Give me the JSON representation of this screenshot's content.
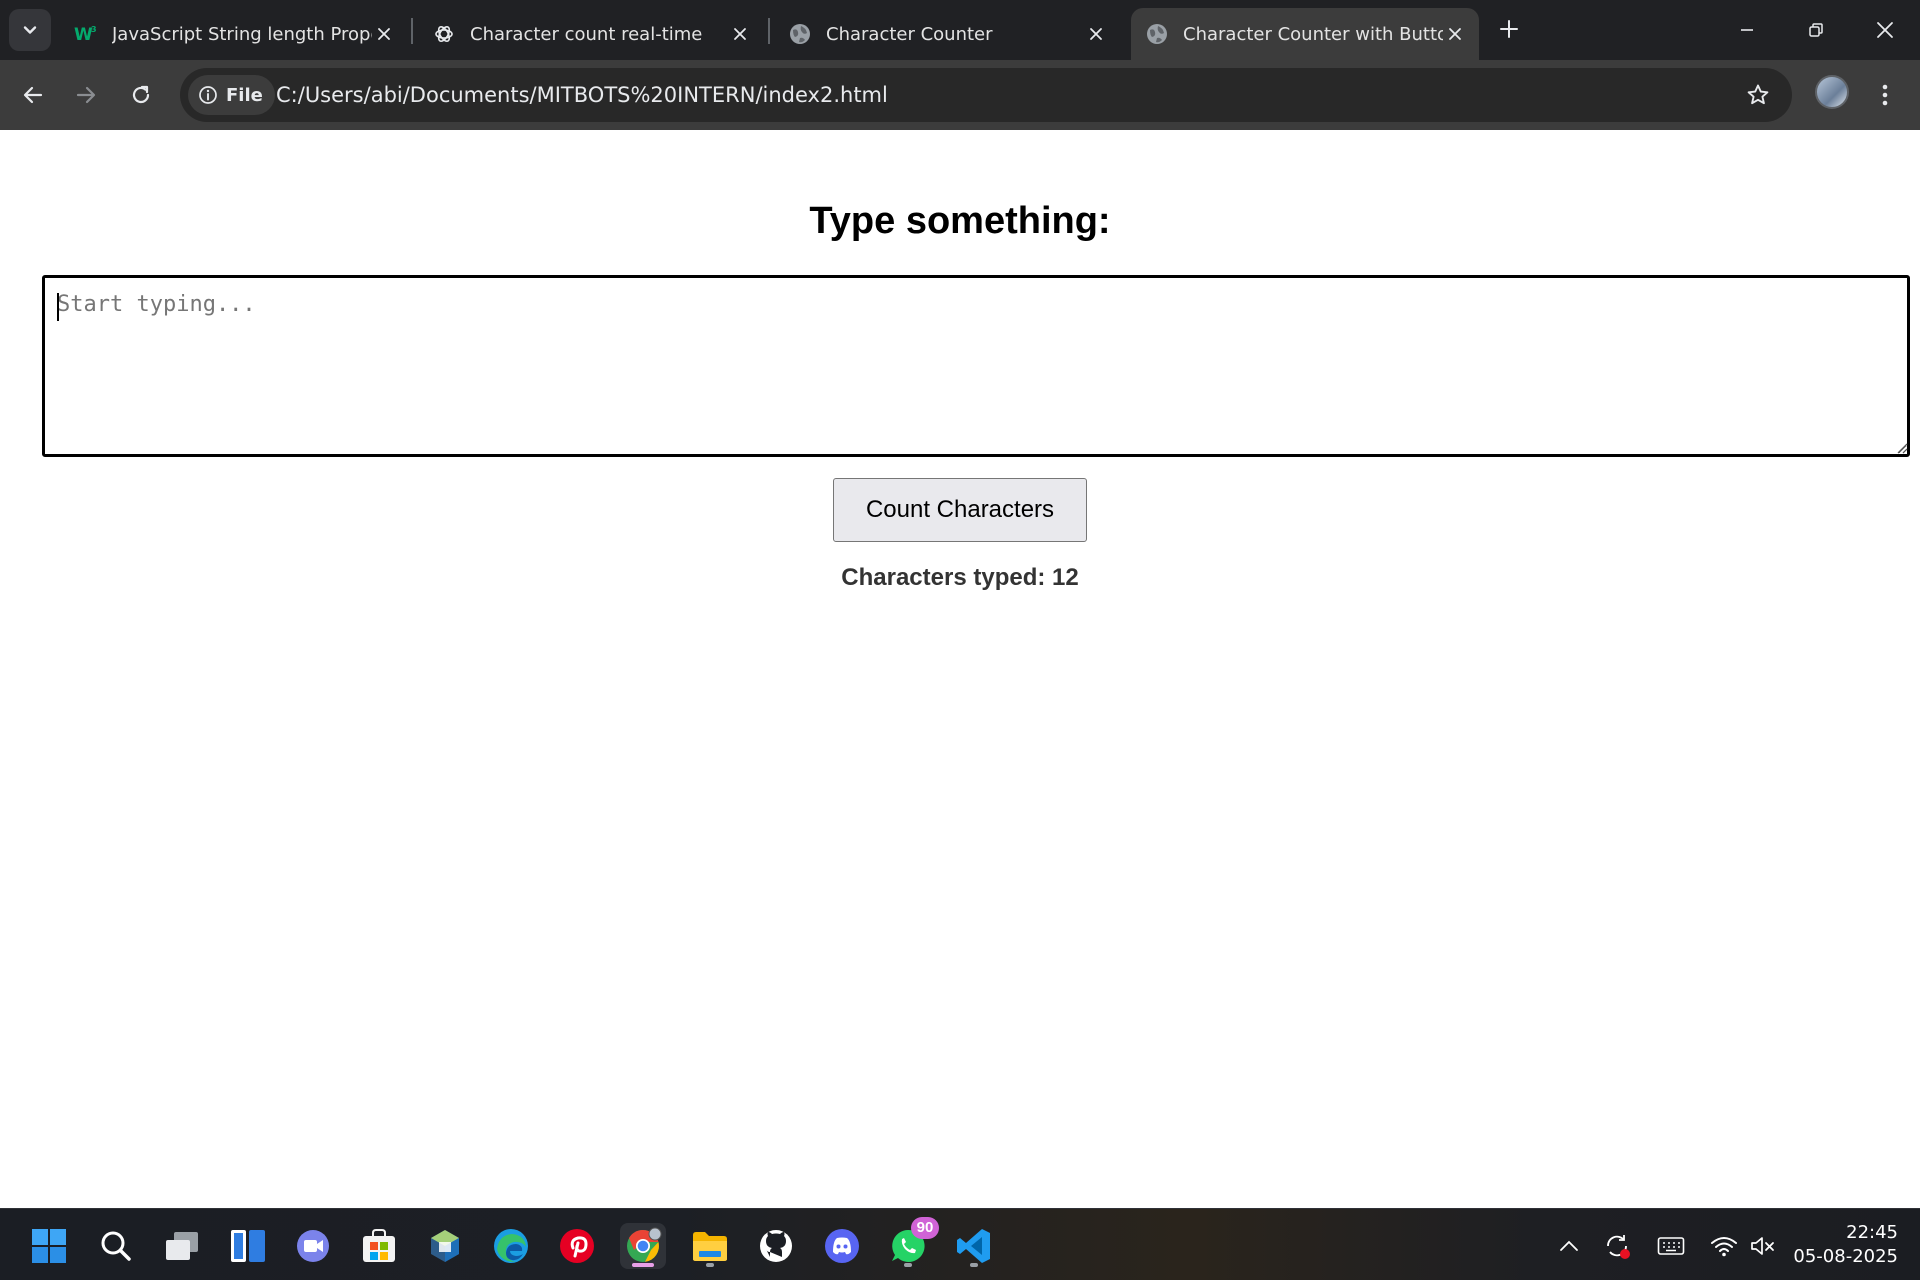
{
  "browser": {
    "tabs": [
      {
        "title": "JavaScript String length Propert",
        "favicon": "w3schools-icon",
        "active": false
      },
      {
        "title": "Character count real-time",
        "favicon": "chatgpt-icon",
        "active": false
      },
      {
        "title": "Character Counter",
        "favicon": "globe-icon",
        "active": false
      },
      {
        "title": "Character Counter with Button",
        "favicon": "globe-icon",
        "active": true
      }
    ],
    "address": {
      "chip_label": "File",
      "url": "C:/Users/abi/Documents/MITBOTS%20INTERN/index2.html"
    }
  },
  "page": {
    "heading": "Type something:",
    "textarea_placeholder": "Start typing...",
    "button_label": "Count Characters",
    "result_text": "Characters typed: 12"
  },
  "taskbar": {
    "apps": [
      "start-icon",
      "search-icon",
      "task-view-icon",
      "widgets-icon",
      "teams-icon",
      "store-icon",
      "virtualbox-icon",
      "edge-icon",
      "pinterest-icon",
      "chrome-icon",
      "file-explorer-icon",
      "github-icon",
      "discord-icon",
      "whatsapp-icon",
      "vscode-icon"
    ],
    "whatsapp_badge": "90",
    "clock_time": "22:45",
    "clock_date": "05-08-2025"
  },
  "colors": {
    "tabstrip_bg": "#202124",
    "toolbar_bg": "#3c3c3c",
    "page_bg": "#ffffff",
    "button_bg": "#e9e9ed",
    "badge_bg": "#d063d6"
  }
}
